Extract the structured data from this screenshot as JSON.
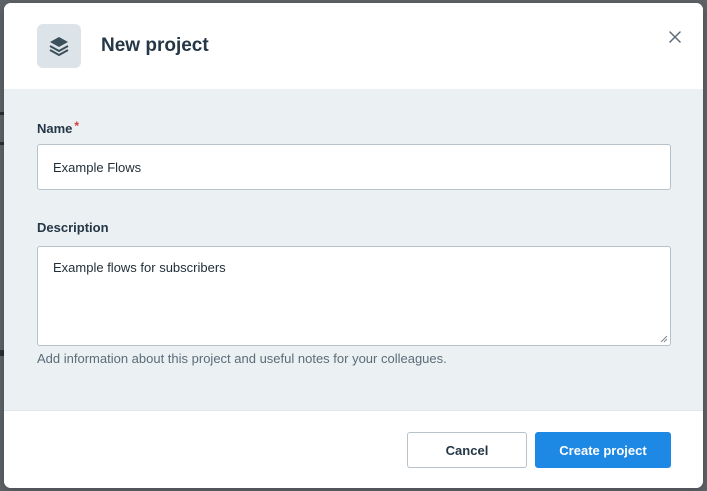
{
  "dialog": {
    "title": "New project",
    "icon": "layers-icon",
    "close_icon": "close-icon"
  },
  "form": {
    "name": {
      "label": "Name",
      "required_marker": "*",
      "value": "Example Flows"
    },
    "description": {
      "label": "Description",
      "value": "Example flows for subscribers",
      "help_text": "Add information about this project and useful notes for your colleagues."
    }
  },
  "footer": {
    "cancel_label": "Cancel",
    "create_label": "Create project"
  },
  "colors": {
    "primary": "#1e88e5",
    "body_background": "#ebf0f3",
    "title_text": "#243746",
    "required": "#d93a3a"
  }
}
